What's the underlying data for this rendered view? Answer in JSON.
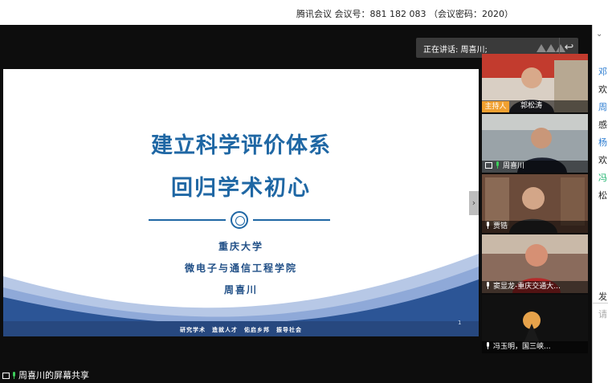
{
  "meeting": {
    "title": "腾讯会议 会议号：881 182 083 （会议密码：2020）"
  },
  "speaking": {
    "label": "正在讲话: 周喜川;"
  },
  "slide": {
    "title_line1": "建立科学评价体系",
    "title_line2": "回归学术初心",
    "org_line1": "重庆大学",
    "org_line2": "微电子与通信工程学院",
    "org_line3": "周喜川",
    "motto": "研究学术　造就人才　佑启乡邦　振导社会",
    "page_number": "1"
  },
  "participants": [
    {
      "name": "郭松涛",
      "role": "主持人"
    },
    {
      "name": "周喜川",
      "role": ""
    },
    {
      "name": "贾锆",
      "role": ""
    },
    {
      "name": "窦显龙-重庆交通大...",
      "role": ""
    },
    {
      "name": "冯玉明，国三峡...",
      "role": ""
    }
  ],
  "screen_share_label": "周喜川的屏幕共享",
  "chat_panel": {
    "rows": [
      {
        "text": "邓",
        "color": "#2a7bd0"
      },
      {
        "text": "欢",
        "color": "#222222"
      },
      {
        "text": "周",
        "color": "#2a7bd0"
      },
      {
        "text": "感",
        "color": "#222222"
      },
      {
        "text": "杨",
        "color": "#2a7bd0"
      },
      {
        "text": "欢",
        "color": "#222222"
      },
      {
        "text": "冯",
        "color": "#1ab26b"
      },
      {
        "text": "松",
        "color": "#222222"
      },
      {
        "text": "发",
        "color": "#333333"
      },
      {
        "text": "请",
        "color": "#aaaaaa"
      }
    ]
  },
  "colors": {
    "slide_title": "#1f67a4",
    "host_badge": "#f0a030",
    "speaking_bg": "#3a3a3a"
  }
}
